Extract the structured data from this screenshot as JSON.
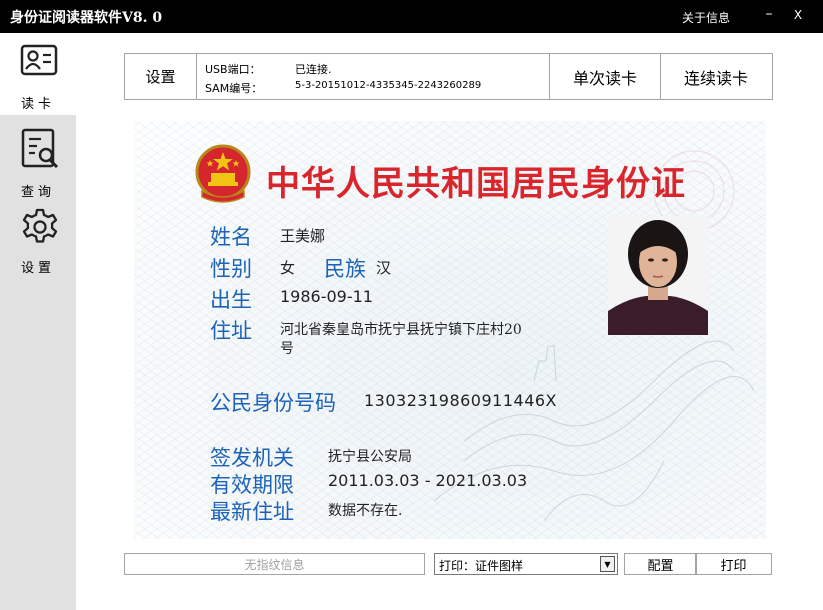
{
  "window": {
    "title": "身份证阅读器软件V8. 0",
    "about": "关于信息",
    "minimize": "–",
    "close": "X"
  },
  "sidebar": {
    "items": [
      {
        "label": "读卡",
        "icon": "id-card-icon",
        "active": true
      },
      {
        "label": "查询",
        "icon": "search-document-icon",
        "active": false
      },
      {
        "label": "设置",
        "icon": "gear-icon",
        "active": false
      }
    ]
  },
  "toolbar": {
    "settings": "设置",
    "usb_label": "USB端口：",
    "usb_value": "已连接.",
    "sam_label": "SAM编号：",
    "sam_value": "5-3-20151012-4335345-2243260289",
    "single_read": "单次读卡",
    "continuous_read": "连续读卡"
  },
  "card": {
    "title": "中华人民共和国居民身份证",
    "name_label": "姓名",
    "name": "王美娜",
    "gender_label": "性别",
    "gender": "女",
    "ethnicity_label": "民族",
    "ethnicity": "汉",
    "birth_label": "出生",
    "birth": "1986-09-11",
    "address_label": "住址",
    "address_line1": "河北省秦皇岛市抚宁县抚宁镇下庄村20",
    "address_line2": "号",
    "id_label": "公民身份号码",
    "id_number": "13032319860911446X",
    "authority_label": "签发机关",
    "authority": "抚宁县公安局",
    "validity_label": "有效期限",
    "validity": "2011.03.03 - 2021.03.03",
    "latest_address_label": "最新住址",
    "latest_address": "数据不存在."
  },
  "bottom": {
    "fingerprint_status": "无指纹信息",
    "print_select": "打印：证件图样",
    "config": "配置",
    "print": "打印"
  },
  "colors": {
    "title_red": "#d9262d",
    "label_blue": "#1c63b8",
    "sidebar_gray": "#e1e1e1",
    "titlebar": "#000000"
  }
}
